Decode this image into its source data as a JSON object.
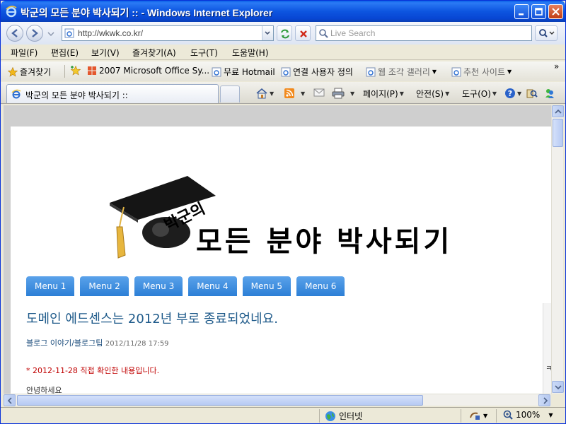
{
  "window": {
    "title": "박군의 모든 분야 박사되기 :: - Windows Internet Explorer"
  },
  "address_bar": {
    "url": "http://wkwk.co.kr/",
    "search_placeholder": "Live Search"
  },
  "menu": [
    "파일(F)",
    "편집(E)",
    "보기(V)",
    "즐겨찾기(A)",
    "도구(T)",
    "도움말(H)"
  ],
  "favorites_bar": {
    "favorites_label": "즐겨찾기",
    "links": [
      "2007 Microsoft Office Sy...",
      "무료 Hotmail",
      "연결 사용자 정의",
      "웹 조각 갤러리",
      "추천 사이트"
    ]
  },
  "tab": {
    "label": "박군의 모든 분야 박사되기 ::"
  },
  "command_bar": {
    "page": "페이지(P)",
    "safety": "안전(S)",
    "tools": "도구(O)"
  },
  "page": {
    "brand_small": "박군의",
    "brand_big": "모든 분야 박사되기",
    "nav": [
      "Menu 1",
      "Menu 2",
      "Menu 3",
      "Menu 4",
      "Menu 5",
      "Menu 6"
    ],
    "post_title": "도메인 에드센스는 2012년 부로 종료되었네요.",
    "post_category": "블로그 이야기/블로그팁",
    "post_date": "2012/11/28 17:59",
    "post_note": "* 2012-11-28 직접 확인한 내용입니다.",
    "post_body_start": "안녕하세요",
    "sidebar_char": "ㅋ"
  },
  "status_bar": {
    "zone": "인터넷",
    "zoom": "100%"
  },
  "colors": {
    "titlebar": "#0a5fe6",
    "nav_tab": "#2c7fd6",
    "post_title": "#1e5a8a",
    "post_note": "#c00000"
  }
}
